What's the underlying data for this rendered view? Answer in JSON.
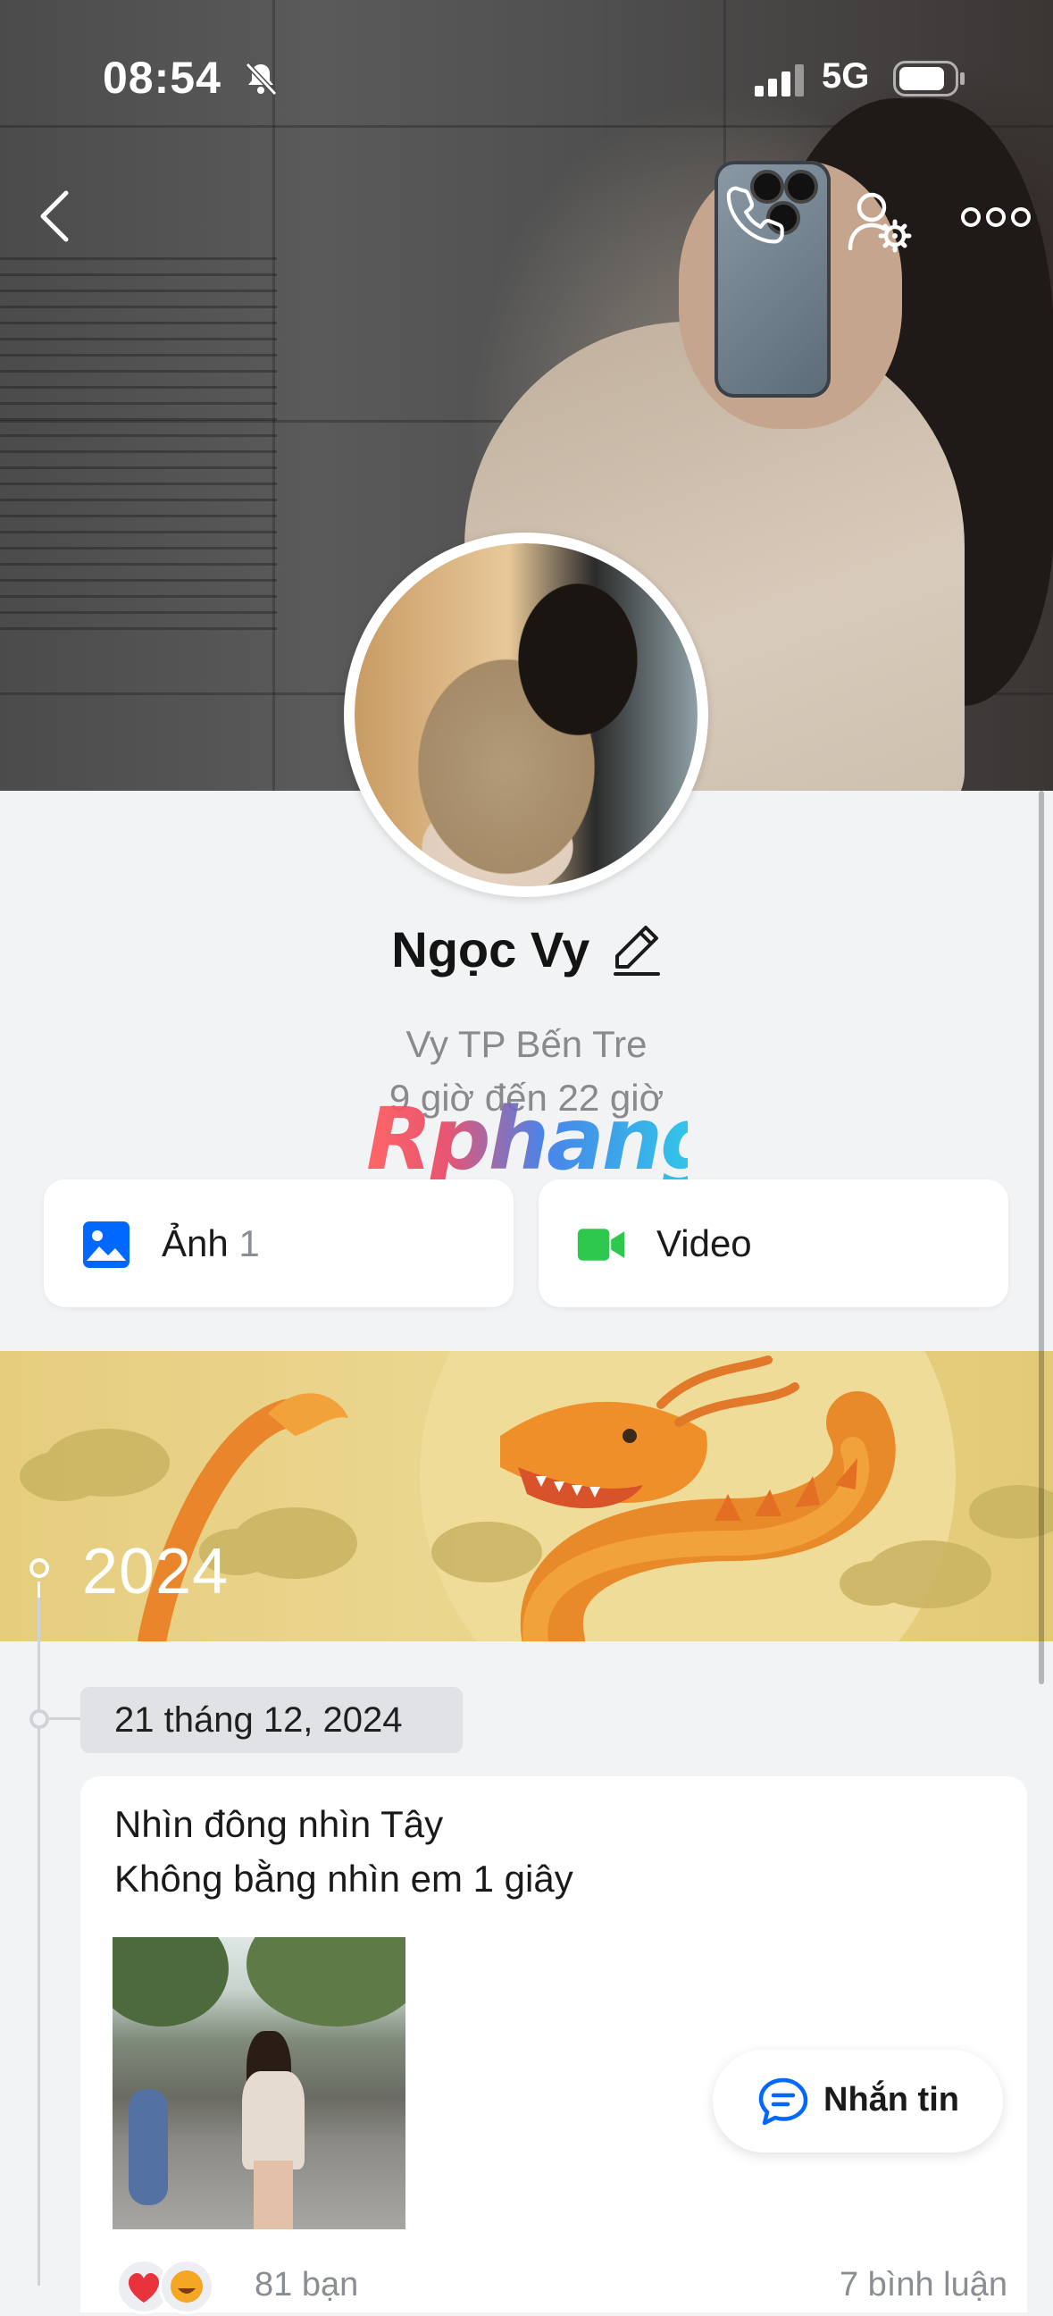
{
  "status_bar": {
    "time": "08:54",
    "network": "5G",
    "icons": [
      "bell-slash-icon",
      "signal-bars-icon",
      "battery-icon"
    ]
  },
  "nav": {
    "icons": [
      "back-chevron-icon",
      "phone-call-icon",
      "user-settings-icon",
      "more-dots-icon"
    ]
  },
  "profile": {
    "name": "Ngọc Vy",
    "bio_line1": "Vy TP Bến Tre",
    "bio_line2": "9 giờ đến 22 giờ",
    "watermark": "Rphang"
  },
  "media_buttons": {
    "photo_label": "Ảnh",
    "photo_count": "1",
    "video_label": "Video"
  },
  "timeline": {
    "year": "2024",
    "date": "21 tháng 12, 2024"
  },
  "post": {
    "line1": "Nhìn đông nhìn Tây",
    "line2": "Không bằng nhìn em 1 giây",
    "reactions_text": "81 bạn",
    "comments_text": "7 bình luận",
    "reaction_icons": [
      "heart-reaction-icon",
      "haha-reaction-icon"
    ]
  },
  "fab": {
    "label": "Nhắn tin"
  },
  "colors": {
    "accent_blue": "#0068ff",
    "video_green": "#2dc84d",
    "banner_gold": "#e6cd7e",
    "background": "#f2f3f5"
  }
}
